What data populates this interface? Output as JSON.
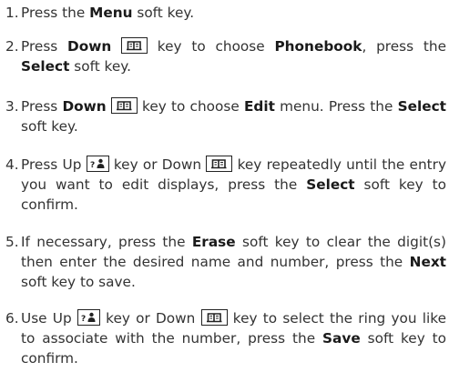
{
  "steps": [
    {
      "num": "1.",
      "t1": "Press the ",
      "menu": "Menu",
      "t2": " soft key."
    },
    {
      "num": "2.",
      "t1": "Press ",
      "down": "Down",
      "t2": " key to choose ",
      "phonebook": "Phonebook",
      "t3": ", press the ",
      "select": "Select",
      "t4": " soft key."
    },
    {
      "num": "3.",
      "t1": "Press ",
      "down": "Down",
      "t2": " key to choose ",
      "edit": "Edit",
      "t3": " menu. Press the ",
      "select": "Select",
      "t4": " soft key."
    },
    {
      "num": "4.",
      "t1": "Press Up ",
      "t2": " key or Down ",
      "t3": " key repeatedly until the entry you want to edit displays, press the ",
      "select": "Select",
      "t4": " soft key to confirm."
    },
    {
      "num": "5.",
      "t1": "If necessary, press the ",
      "erase": "Erase",
      "t2": " soft key to clear the digit(s) then enter the desired name and number, press the ",
      "next": "Next",
      "t3": " soft key to save."
    },
    {
      "num": "6.",
      "t1": "Use Up ",
      "t2": " key or Down ",
      "t3": " key to select the ring you like to associate with the number, press the ",
      "save": "Save",
      "t4": " soft key to confirm."
    }
  ],
  "icons": {
    "down_key": "phonebook-key-icon",
    "up_key": "redial-key-icon"
  }
}
